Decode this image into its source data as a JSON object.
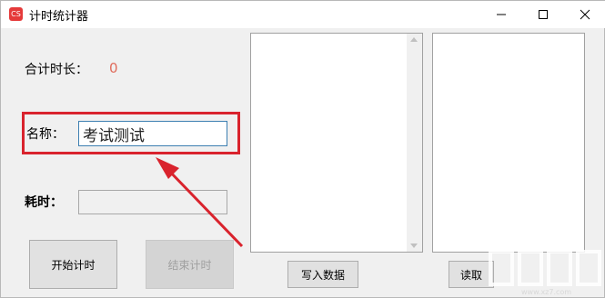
{
  "window": {
    "title": "计时统计器",
    "icon": "app-logo-icon",
    "controls": [
      "minimize-icon",
      "maximize-icon",
      "close-icon"
    ]
  },
  "form": {
    "total_label": "合计时长：",
    "total_value": "0",
    "name_label": "名称：",
    "name_value": "考试测试",
    "time_label": "耗时：",
    "time_value": ""
  },
  "buttons": {
    "start": "开始计时",
    "stop": "结束计时",
    "write": "写入数据",
    "read": "读取"
  },
  "lists": {
    "left_items": [],
    "right_items": []
  },
  "annotation": {
    "highlight_color": "#d9232d",
    "arrow_color": "#d9232d"
  },
  "watermark": {
    "text": "www.xz7.com"
  }
}
